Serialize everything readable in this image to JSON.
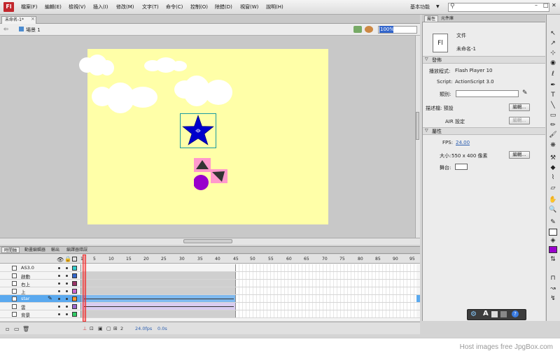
{
  "app": {
    "logo": "Fl"
  },
  "menu": [
    "檔案(F)",
    "編輯(E)",
    "檢視(V)",
    "插入(I)",
    "修改(M)",
    "文字(T)",
    "命令(C)",
    "控制(O)",
    "除錯(D)",
    "視窗(W)",
    "說明(H)"
  ],
  "workspace": {
    "label": "基本功能"
  },
  "document": {
    "tab_title": "未命名-1*",
    "scene_label": "場景 1",
    "zoom": "100%"
  },
  "timeline": {
    "tabs": [
      "時間軸",
      "動畫編輯器",
      "輸出",
      "編譯器錯誤"
    ],
    "frame_numbers": [
      "1",
      "5",
      "10",
      "15",
      "20",
      "25",
      "30",
      "35",
      "40",
      "45",
      "50",
      "55",
      "60",
      "65",
      "70",
      "75",
      "80",
      "85",
      "90",
      "95"
    ],
    "layers": [
      {
        "name": "AS3.0",
        "color": "#33cccc",
        "selected": false
      },
      {
        "name": "啟動",
        "color": "#3366cc",
        "selected": false
      },
      {
        "name": "右上",
        "color": "#993366",
        "selected": false
      },
      {
        "name": "上",
        "color": "#cc66cc",
        "selected": false
      },
      {
        "name": "star",
        "color": "#ff9933",
        "selected": true
      },
      {
        "name": "雲",
        "color": "#9966cc",
        "selected": false
      },
      {
        "name": "背景",
        "color": "#33cc66",
        "selected": false
      }
    ],
    "footer": {
      "current_frame": "2",
      "fps": "24.0fps",
      "time": "0.0s"
    }
  },
  "panel": {
    "tabs": [
      "屬性",
      "元件庫"
    ],
    "doc_icon": "Fl",
    "doc_type": "文件",
    "doc_name": "未命名-1",
    "publish_header": "發佈",
    "player_label": "播放程式:",
    "player_value": "Flash Player 10",
    "script_label": "Script:",
    "script_value": "ActionScript 3.0",
    "class_label": "類別:",
    "profile_label": "描述檔: 預設",
    "edit_button": "編輯...",
    "air_label": "AIR 設定",
    "properties_header": "屬性",
    "fps_label": "FPS:",
    "fps_value": "24.00",
    "size_label": "大小:",
    "size_value": "550 x 400 像素",
    "stage_label": "舞台:"
  },
  "colors": {
    "stage": "#ffffa8",
    "star": "#0000cc",
    "selected_layer": "#5aa9ef"
  },
  "watermark": "Host images free JpgBox.com"
}
